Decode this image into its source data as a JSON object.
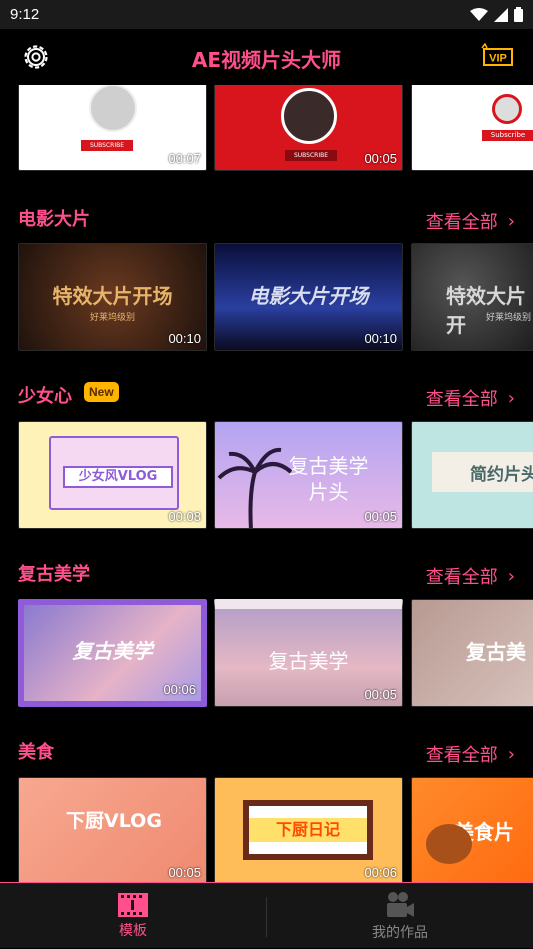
{
  "status": {
    "time": "9:12"
  },
  "header": {
    "title": "AE视频片头大师",
    "vip_label": "VIP"
  },
  "top_row": {
    "items": [
      {
        "label": "SUBSCRIBE",
        "duration": "00:07",
        "bg": "#ffffff"
      },
      {
        "label": "SUBSCRIBE",
        "duration": "00:05",
        "bg": "#d8141c"
      },
      {
        "label": "Subscribe",
        "duration": "",
        "bg": "#ffffff"
      }
    ]
  },
  "sections": [
    {
      "title": "电影大片",
      "view_all": "查看全部",
      "badge": "",
      "items": [
        {
          "caption": "特效大片开场",
          "sub": "好莱坞级别",
          "duration": "00:10",
          "bg": "#3a2418",
          "fg": "#e8b46a"
        },
        {
          "caption": "电影大片开场",
          "sub": "",
          "duration": "00:10",
          "bg": "#1c2a6a",
          "fg": "#d9ddf0"
        },
        {
          "caption": "特效大片开",
          "sub": "好莱坞级别",
          "duration": "",
          "bg": "#333333",
          "fg": "#d8d8d8"
        }
      ]
    },
    {
      "title": "少女心",
      "view_all": "查看全部",
      "badge": "New",
      "items": [
        {
          "caption": "少女风VLOG",
          "sub": "",
          "duration": "00:08",
          "bg": "#fff2b8",
          "fg": "#8f5bd8"
        },
        {
          "caption": "复古美学",
          "sub": "片头",
          "duration": "00:05",
          "bg": "#c9b6ef",
          "fg": "#ffffff"
        },
        {
          "caption": "简约片头",
          "sub": "",
          "duration": "",
          "bg": "#bfe5e2",
          "fg": "#4a6a6a"
        }
      ]
    },
    {
      "title": "复古美学",
      "view_all": "查看全部",
      "badge": "",
      "items": [
        {
          "caption": "复古美学",
          "sub": "",
          "duration": "00:06",
          "bg": "#9b8ad8",
          "fg": "#ffffff"
        },
        {
          "caption": "复古美学",
          "sub": "",
          "duration": "00:05",
          "bg": "#c9a6b8",
          "fg": "#ffffff"
        },
        {
          "caption": "复古美",
          "sub": "",
          "duration": "",
          "bg": "#c7aaa2",
          "fg": "#ffffff"
        }
      ]
    },
    {
      "title": "美食",
      "view_all": "查看全部",
      "badge": "",
      "items": [
        {
          "caption": "下厨VLOG",
          "sub": "",
          "duration": "00:05",
          "bg": "#f39a82",
          "fg": "#ffffff"
        },
        {
          "caption": "下厨日记",
          "sub": "",
          "duration": "00:06",
          "bg": "#ffbd5a",
          "fg": "#ff4a00"
        },
        {
          "caption": "美食片",
          "sub": "",
          "duration": "",
          "bg": "#ff7a1a",
          "fg": "#ffffff"
        }
      ]
    }
  ],
  "bottom_nav": {
    "items": [
      {
        "label": "模板",
        "active": true
      },
      {
        "label": "我的作品",
        "active": false
      }
    ]
  },
  "colors": {
    "accent": "#ff4f8c",
    "badge": "#ffb400",
    "background": "#000000"
  }
}
